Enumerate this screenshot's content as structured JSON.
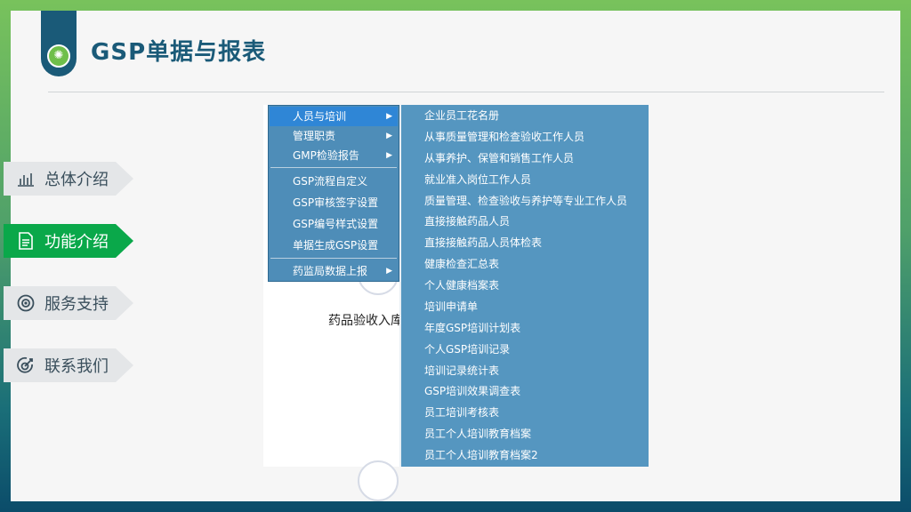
{
  "header": {
    "title": "GSP单据与报表"
  },
  "nav": {
    "items": [
      {
        "label": "总体介绍",
        "icon": "bar-chart-icon"
      },
      {
        "label": "功能介绍",
        "icon": "document-icon"
      },
      {
        "label": "服务支持",
        "icon": "target-icon"
      },
      {
        "label": "联系我们",
        "icon": "dart-target-icon"
      }
    ],
    "active_index": 1
  },
  "screenshot": {
    "background_text": "药品验收入库",
    "menu": {
      "items": [
        {
          "label": "人员与培训",
          "has_submenu": true,
          "highlighted": true
        },
        {
          "label": "管理职责",
          "has_submenu": true
        },
        {
          "label": "GMP检验报告",
          "has_submenu": true
        },
        {
          "label": "GSP流程自定义"
        },
        {
          "label": "GSP审核签字设置"
        },
        {
          "label": "GSP编号样式设置"
        },
        {
          "label": "单据生成GSP设置"
        },
        {
          "label": "药监局数据上报",
          "has_submenu": true
        }
      ]
    },
    "submenu": {
      "items": [
        "企业员工花名册",
        "从事质量管理和检查验收工作人员",
        "从事养护、保管和销售工作人员",
        "就业准入岗位工作人员",
        "质量管理、检查验收与养护等专业工作人员",
        "直接接触药品人员",
        "直接接触药品人员体检表",
        "健康检查汇总表",
        "个人健康档案表",
        "培训申请单",
        "年度GSP培训计划表",
        "个人GSP培训记录",
        "培训记录统计表",
        "GSP培训效果调查表",
        "员工培训考核表",
        "员工个人培训教育档案",
        "员工个人培训教育档案2"
      ]
    }
  },
  "colors": {
    "brand_dark": "#1a5a78",
    "active_green": "#0aa84a",
    "menu_blue": "#4e8db8",
    "menu_highlight": "#2f86d6"
  }
}
